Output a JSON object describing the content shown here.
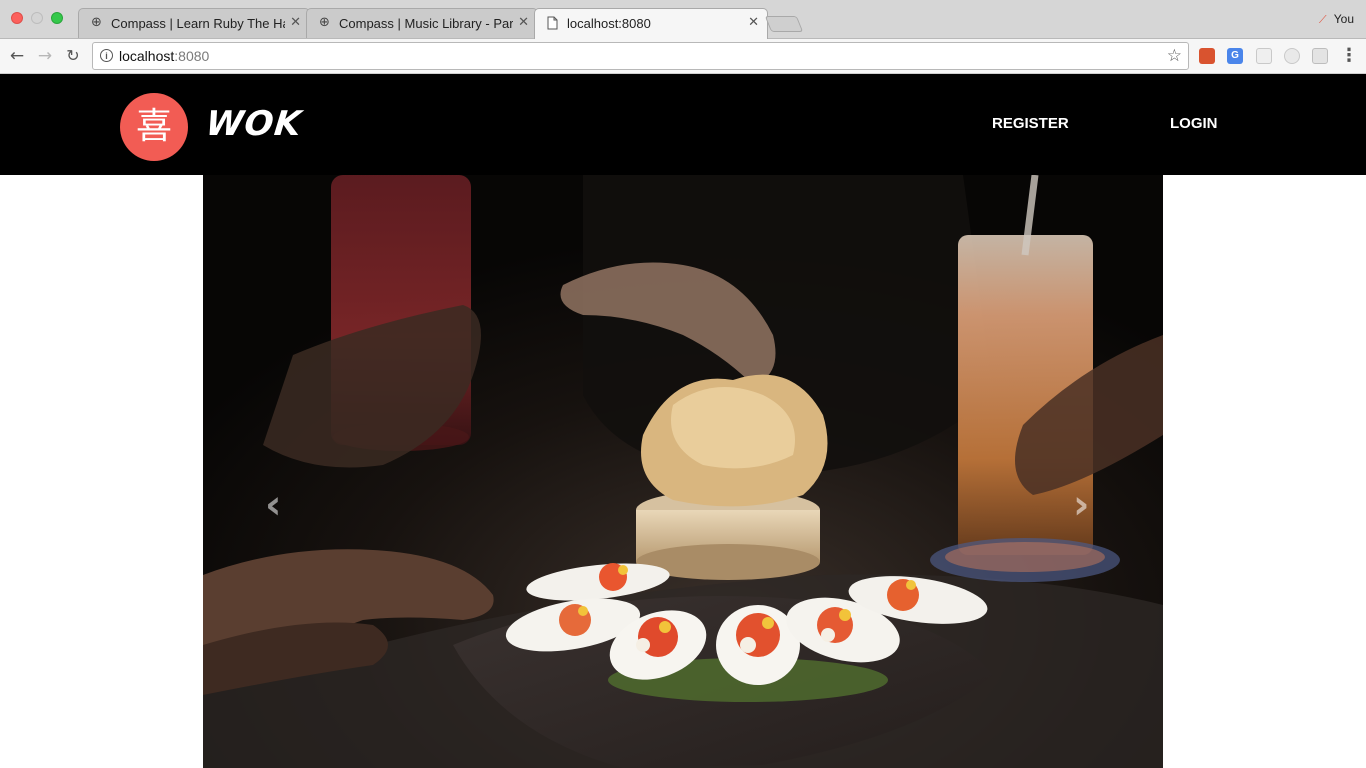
{
  "browser": {
    "tabs": [
      {
        "title": "Compass | Learn Ruby The Ha",
        "icon": "globe-icon",
        "active": false
      },
      {
        "title": "Compass | Music Library - Par",
        "icon": "globe-icon",
        "active": false
      },
      {
        "title": "localhost:8080",
        "icon": "page-icon",
        "active": true
      }
    ],
    "tab_close_glyph": "✕",
    "profile_label": "You",
    "address": {
      "host": "localhost",
      "port": ":8080"
    },
    "info_glyph": "i"
  },
  "site": {
    "logo_char": "喜",
    "brand": "WOK",
    "nav": {
      "register": "REGISTER",
      "login": "LOGIN"
    },
    "accent_color": "#f25c54",
    "header_bg": "#000000"
  },
  "carousel": {
    "prev_glyph": "‹",
    "next_glyph": "›",
    "image_subject": "tapas spoons with shrimp and chips on slate board"
  }
}
